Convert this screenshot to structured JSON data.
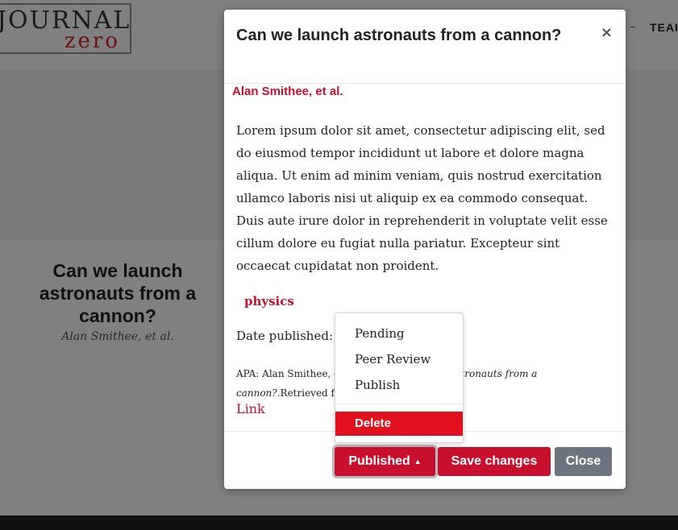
{
  "site": {
    "logo_top": "JOURNAL",
    "logo_bottom": "zero",
    "nav_partial": "TEAI"
  },
  "article_card": {
    "title": "Can we launch astronauts from a cannon?",
    "author": "Alan Smithee, et al."
  },
  "modal": {
    "title": "Can we launch astronauts from a cannon?",
    "close_symbol": "×",
    "author": "Alan Smithee, et al.",
    "abstract": "Lorem ipsum dolor sit amet, consectetur adipiscing elit, sed do eiusmod tempor incididunt ut labore et dolore magna aliqua. Ut enim ad minim veniam, quis nostrud exercitation ullamco laboris nisi ut aliquip ex ea commodo consequat. Duis aute irure dolor in reprehenderit in voluptate velit esse cillum dolore eu fugiat nulla pariatur. Excepteur sint occaecat cupidatat non proident.",
    "tag": "physics",
    "date_label": "Date published:",
    "citation_prefix": "APA: Alan Smithee, e",
    "citation_italic": "aunch astronauts from a cannon?",
    "citation_suffix": ".Retrieved fr",
    "link_label": "Link",
    "buttons": {
      "status_label": "Published",
      "status_caret": "▲",
      "save_label": "Save changes",
      "close_label": "Close"
    }
  },
  "dropdown": {
    "items": [
      "Pending",
      "Peer Review",
      "Publish"
    ],
    "danger_item": "Delete"
  },
  "colors": {
    "brand_red": "#c8102e",
    "danger_red": "#e0101e",
    "secondary_gray": "#6c757d",
    "backdrop": "#808080"
  }
}
